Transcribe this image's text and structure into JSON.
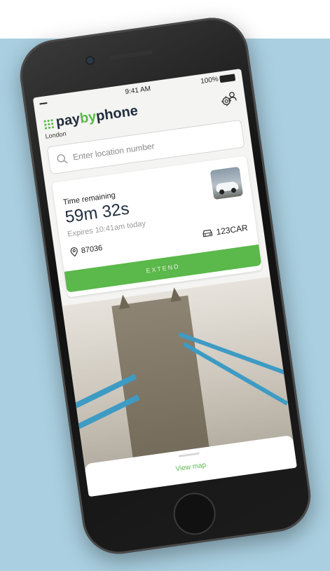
{
  "status_bar": {
    "signal": "•••••",
    "time": "9:41 AM",
    "battery": "100%"
  },
  "header": {
    "brand_pay": "pay",
    "brand_by": "by",
    "brand_phone": "phone",
    "city": "London"
  },
  "search": {
    "placeholder": "Enter location number"
  },
  "session": {
    "time_remaining_label": "Time remaining",
    "time_remaining_value": "59m 32s",
    "expires": "Expires 10:41am today",
    "location_number": "87036",
    "plate": "123CAR",
    "extend_label": "EXTEND"
  },
  "bottom_sheet": {
    "view_map_label": "View map"
  },
  "colors": {
    "brand_green": "#5bb84a",
    "brand_navy": "#1f2d3d",
    "background_blue": "#a9cfe0",
    "cable_blue": "#3d9bc4"
  },
  "icons": {
    "settings": "gear-user-icon",
    "search": "search-icon",
    "location": "location-pin-icon",
    "vehicle": "car-icon"
  }
}
